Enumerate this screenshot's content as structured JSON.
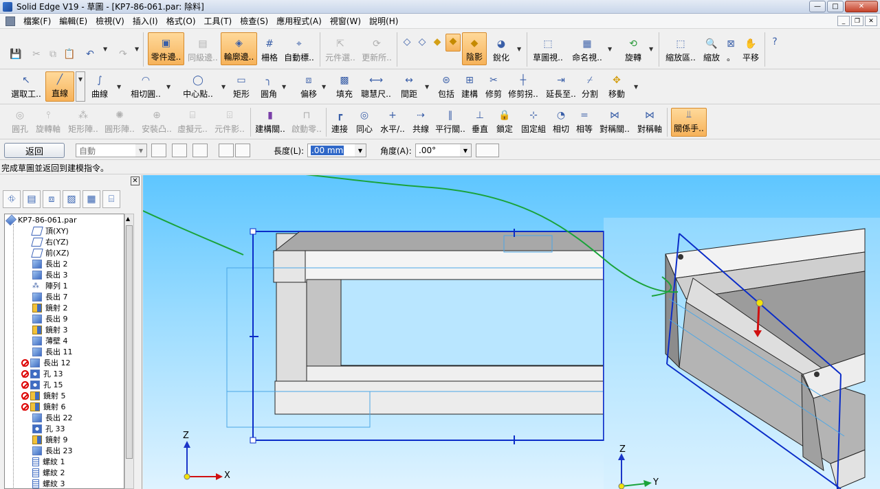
{
  "window": {
    "title": "Solid Edge V19 - 草圖 - [KP7-86-061.par: 除料]",
    "controls": [
      "—",
      "□",
      "✕"
    ]
  },
  "menu": [
    "檔案(F)",
    "編輯(E)",
    "檢視(V)",
    "插入(I)",
    "格式(O)",
    "工具(T)",
    "檢查(S)",
    "應用程式(A)",
    "視窗(W)",
    "說明(H)"
  ],
  "toolbar1": {
    "part_edge": "零件邊..",
    "same_level": "同級邊..",
    "outline_edge": "輪廓邊..",
    "grid": "柵格",
    "auto_mark": "自動標..",
    "element_select": "元件選..",
    "update_all": "更新所..",
    "shading": "陰影",
    "sharpen": "銳化",
    "sketch_view": "草圖視..",
    "named_view": "命名視..",
    "rotate": "旋轉",
    "zoom_area": "縮放區..",
    "zoom": "縮放",
    "fit": "。",
    "pan": "平移"
  },
  "toolbar2": {
    "select": "選取工..",
    "line": "直線",
    "curve": "曲線",
    "tangent_arc": "相切圓..",
    "center_point": "中心點..",
    "rectangle": "矩形",
    "fillet": "圓角",
    "offset": "偏移",
    "fill": "填充",
    "smart_dim": "聰慧尺..",
    "spacing": "間距",
    "include": "包括",
    "construction": "建構",
    "trim": "修剪",
    "trim_corner": "修剪拐..",
    "extend": "延長至..",
    "split": "分割",
    "move": "移動"
  },
  "toolbar3": {
    "circle_hole": "圓孔",
    "revolve_axis": "旋轉軸",
    "rect_array": "矩形陣..",
    "circ_array": "圓形陣..",
    "mount_boss": "安裝凸..",
    "virtual_elem": "虛擬元..",
    "elem_shadow": "元件影..",
    "construct_rel": "建構關..",
    "startup_part": "啟動零..",
    "connect": "連接",
    "concentric": "同心",
    "horiz_vert": "水平/..",
    "collinear": "共線",
    "parallel": "平行關..",
    "perpendicular": "垂直",
    "lock": "鎖定",
    "fixed_group": "固定組",
    "tangent": "相切",
    "equal": "相等",
    "symmetric_rel": "對稱關..",
    "symmetric_axis": "對稱軸",
    "relation_hand": "關係手.."
  },
  "ribbon": {
    "return": "返回",
    "mode_value": "自動",
    "length_label": "長度(L):",
    "length_value": ".00 mm",
    "angle_label": "角度(A):",
    "angle_value": ".00°"
  },
  "status": "完成草圖並返回到建模指令。",
  "tree": {
    "root": "KP7-86-061.par",
    "items": [
      {
        "label": "頂(XY)",
        "type": "plane",
        "err": false
      },
      {
        "label": "右(YZ)",
        "type": "plane",
        "err": false
      },
      {
        "label": "前(XZ)",
        "type": "plane",
        "err": false
      },
      {
        "label": "長出 2",
        "type": "protrude",
        "err": false
      },
      {
        "label": "長出 3",
        "type": "protrude",
        "err": false
      },
      {
        "label": "陣列 1",
        "type": "pattern",
        "err": false
      },
      {
        "label": "長出 7",
        "type": "protrude",
        "err": false
      },
      {
        "label": "鏡射 2",
        "type": "mirror",
        "err": false
      },
      {
        "label": "長出 9",
        "type": "protrude",
        "err": false
      },
      {
        "label": "鏡射 3",
        "type": "mirror",
        "err": false
      },
      {
        "label": "薄壁 4",
        "type": "protrude",
        "err": false
      },
      {
        "label": "長出 11",
        "type": "protrude",
        "err": false
      },
      {
        "label": "長出 12",
        "type": "protrude",
        "err": true
      },
      {
        "label": "孔 13",
        "type": "hole",
        "err": true
      },
      {
        "label": "孔 15",
        "type": "hole",
        "err": true
      },
      {
        "label": "鏡射 5",
        "type": "mirror",
        "err": true
      },
      {
        "label": "鏡射 6",
        "type": "mirror",
        "err": true
      },
      {
        "label": "長出 22",
        "type": "protrude",
        "err": false
      },
      {
        "label": "孔 33",
        "type": "hole",
        "err": false
      },
      {
        "label": "鏡射 9",
        "type": "mirror",
        "err": false
      },
      {
        "label": "長出 23",
        "type": "protrude",
        "err": false
      },
      {
        "label": "螺紋 1",
        "type": "thread",
        "err": false
      },
      {
        "label": "螺紋 2",
        "type": "thread",
        "err": false
      },
      {
        "label": "螺紋 3",
        "type": "thread",
        "err": false
      }
    ]
  },
  "axes_left": {
    "z": "Z",
    "x": "X"
  },
  "axes_right": {
    "z": "Z",
    "y": "Y"
  },
  "colors": {
    "active": "#f6b25a",
    "sketch_line": "#0a2cc8",
    "annotation": "#1aa33a",
    "viewport_top": "#5ec6ff"
  }
}
